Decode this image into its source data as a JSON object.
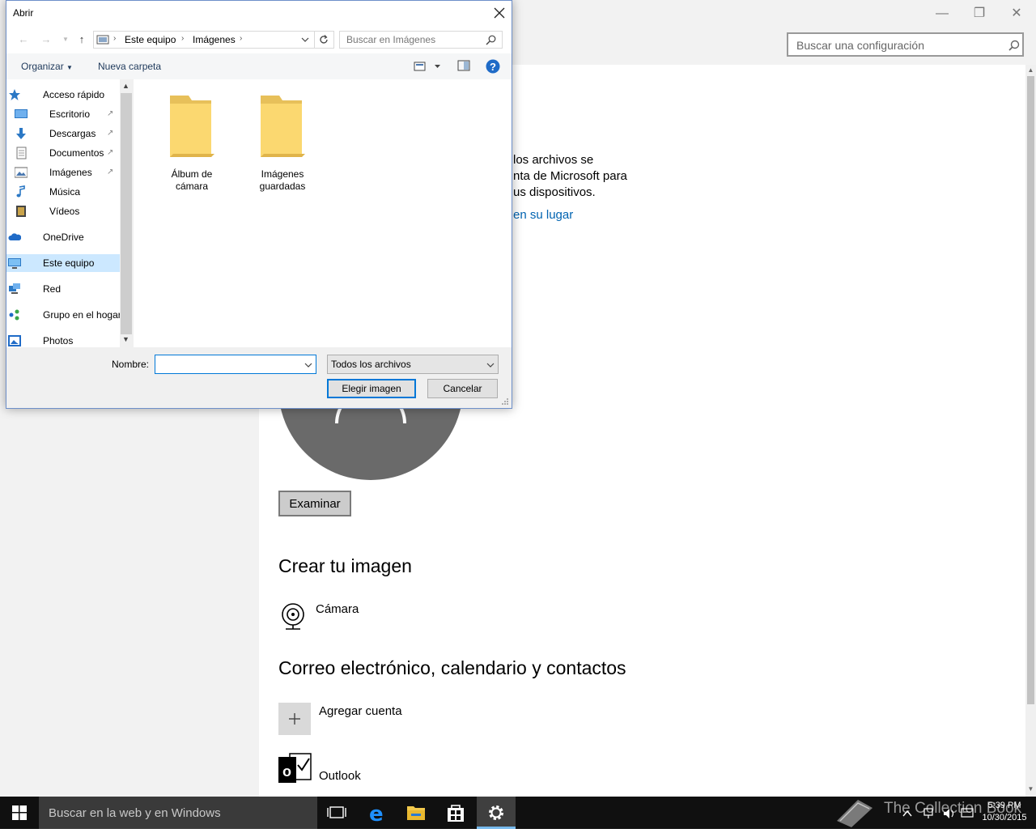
{
  "settings": {
    "search_placeholder": "Buscar una configuración",
    "text_line1": "los archivos se",
    "text_line2": "nta de Microsoft para",
    "text_line3": "us dispositivos.",
    "link_text": "en su lugar",
    "browse_label": "Examinar",
    "create_heading": "Crear tu imagen",
    "camera_label": "Cámara",
    "accounts_heading": "Correo electrónico, calendario y contactos",
    "add_account_label": "Agregar cuenta",
    "outlook_label": "Outlook"
  },
  "dialog": {
    "title": "Abrir",
    "breadcrumb": [
      "Este equipo",
      "Imágenes"
    ],
    "search_placeholder": "Buscar en Imágenes",
    "organize_label": "Organizar",
    "new_folder_label": "Nueva carpeta",
    "nav_items": [
      {
        "label": "Acceso rápido",
        "icon": "star-icon"
      },
      {
        "label": "Escritorio",
        "icon": "desktop-icon",
        "pinned": true
      },
      {
        "label": "Descargas",
        "icon": "download-icon",
        "pinned": true
      },
      {
        "label": "Documentos",
        "icon": "document-icon",
        "pinned": true
      },
      {
        "label": "Imágenes",
        "icon": "pictures-icon",
        "pinned": true
      },
      {
        "label": "Música",
        "icon": "music-icon"
      },
      {
        "label": "Vídeos",
        "icon": "video-icon"
      },
      {
        "label": "OneDrive",
        "icon": "cloud-icon"
      },
      {
        "label": "Este equipo",
        "icon": "computer-icon",
        "selected": true
      },
      {
        "label": "Red",
        "icon": "network-icon"
      },
      {
        "label": "Grupo en el hogar",
        "icon": "homegroup-icon"
      },
      {
        "label": "Photos",
        "icon": "photos-icon"
      }
    ],
    "folders": [
      {
        "line1": "Álbum de",
        "line2": "cámara"
      },
      {
        "line1": "Imágenes",
        "line2": "guardadas"
      }
    ],
    "filename_label": "Nombre:",
    "filename_value": "",
    "file_type": "Todos los archivos",
    "choose_label": "Elegir imagen",
    "cancel_label": "Cancelar"
  },
  "taskbar": {
    "search_placeholder": "Buscar en la web y en Windows",
    "time": "5:39 PM",
    "date": "10/30/2015",
    "watermark": "The Collection Book"
  },
  "colors": {
    "accent": "#0078d7",
    "link": "#0063b1",
    "taskbar": "#101010"
  }
}
